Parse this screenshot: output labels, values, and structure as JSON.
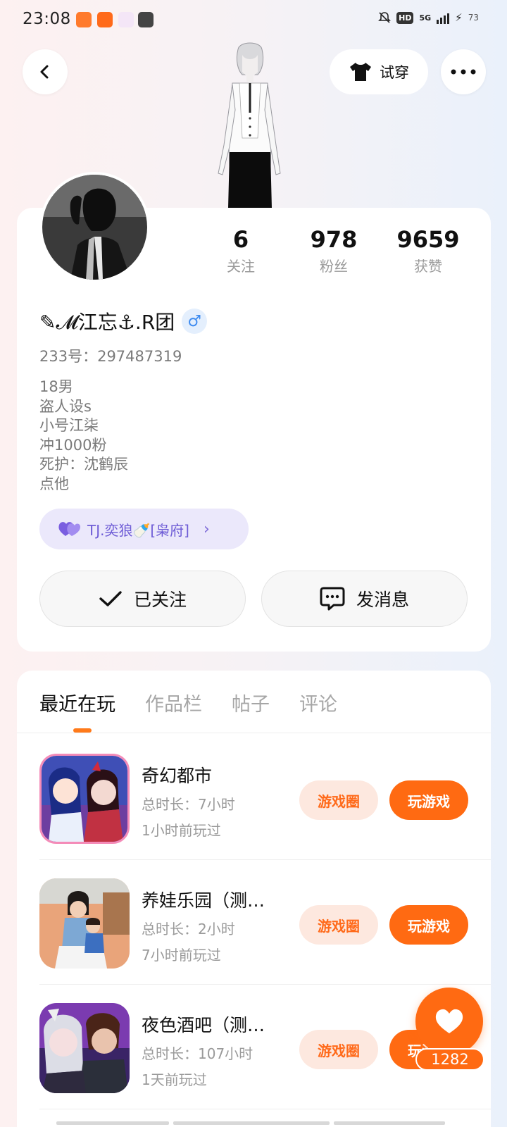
{
  "status_bar": {
    "time": "23:08",
    "network": "5G",
    "hd": "HD",
    "battery": "73"
  },
  "nav": {
    "tryon_label": "试穿"
  },
  "profile": {
    "stats": [
      {
        "value": "6",
        "label": "关注"
      },
      {
        "value": "978",
        "label": "粉丝"
      },
      {
        "value": "9659",
        "label": "获赞"
      }
    ],
    "nickname": "✎𝓜江忘⚓.R团",
    "gender": "♂",
    "uid": "233号：297487319",
    "bio": [
      "18男",
      "盗人设s",
      "小号江柒",
      "冲1000粉",
      "死护：沈鹤辰",
      "点他"
    ],
    "guild": "TJ.奕狼🍼[枭府]",
    "follow_label": "已关注",
    "message_label": "发消息"
  },
  "tabs": [
    {
      "label": "最近在玩",
      "active": true
    },
    {
      "label": "作品栏",
      "active": false
    },
    {
      "label": "帖子",
      "active": false
    },
    {
      "label": "评论",
      "active": false
    }
  ],
  "games": [
    {
      "title": "奇幻都市",
      "duration": "总时长：7小时",
      "last": "1小时前玩过",
      "circle_label": "游戏圈",
      "play_label": "玩游戏"
    },
    {
      "title": "养娃乐园（测…",
      "duration": "总时长：2小时",
      "last": "7小时前玩过",
      "circle_label": "游戏圈",
      "play_label": "玩游戏"
    },
    {
      "title": "夜色酒吧（测…",
      "duration": "总时长：107小时",
      "last": "1天前玩过",
      "circle_label": "游戏圈",
      "play_label": "玩游戏"
    }
  ],
  "like_fab": {
    "count": "1282"
  },
  "colors": {
    "accent": "#ff6a12",
    "accent_light": "#fde8df",
    "guild_bg": "#ebe8fb",
    "guild_text": "#6e5cd6",
    "gender": "#3d8bf0"
  }
}
